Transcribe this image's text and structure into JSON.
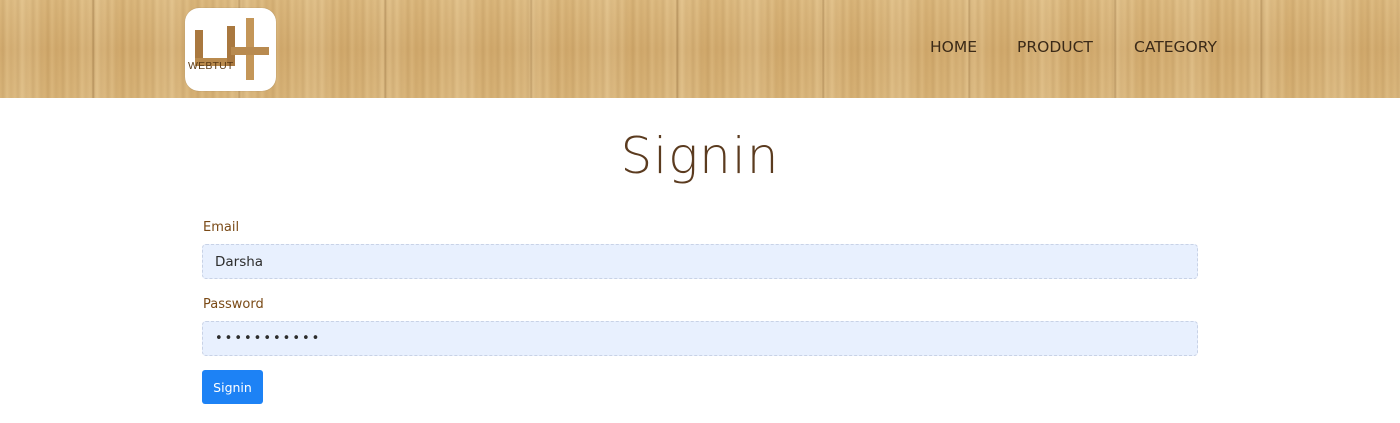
{
  "header": {
    "logo": {
      "text": "WEBTUT",
      "icon": "webtut-logo-icon"
    },
    "nav": {
      "home": "HOME",
      "product": "PRODUCT",
      "category": "CATEGORY"
    }
  },
  "main": {
    "title": "Signin",
    "email": {
      "label": "Email",
      "value": "Darsha"
    },
    "password": {
      "label": "Password",
      "value": "•••••••••••"
    },
    "submit_label": "Signin"
  },
  "colors": {
    "accent": "#1d82f5",
    "title": "#5b3b1f",
    "label": "#7a4a16",
    "input_bg": "#e8f0fe",
    "header_wood": "#d6b279"
  }
}
